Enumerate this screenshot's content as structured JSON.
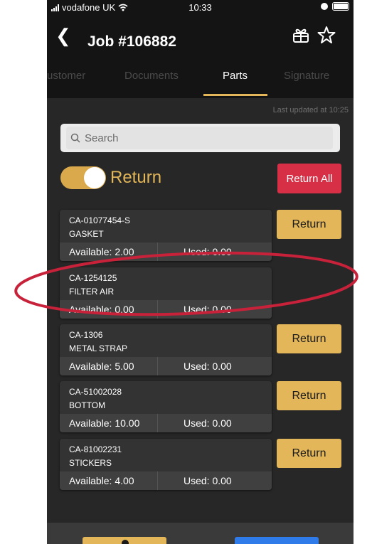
{
  "status_bar": {
    "carrier": "vodafone UK",
    "time": "10:33",
    "icons": [
      "signal-icon",
      "wifi-icon",
      "do-not-disturb-icon",
      "battery-icon"
    ]
  },
  "header": {
    "title": "Job #106882",
    "back_icon": "chevron-left-icon",
    "actions": [
      "gift-icon",
      "star-icon"
    ]
  },
  "tabs": [
    {
      "label": "ustomer",
      "active": false
    },
    {
      "label": "Documents",
      "active": false
    },
    {
      "label": "Parts",
      "active": true
    },
    {
      "label": "Signature",
      "active": false
    }
  ],
  "parts_page": {
    "last_updated": "Last updated at 10:25",
    "search_placeholder": "Search",
    "toggle_label": "Return",
    "toggle_on": true,
    "return_all_label": "Return All",
    "return_button_label": "Return",
    "items": [
      {
        "code": "CA-01077454-S",
        "name": "GASKET",
        "available": "Available: 2.00",
        "used": "Used: 0.00",
        "has_return": true
      },
      {
        "code": "CA-1254125",
        "name": "FILTER AIR",
        "available": "Available: 0.00",
        "used": "Used: 0.00",
        "has_return": false
      },
      {
        "code": "CA-1306",
        "name": "METAL STRAP",
        "available": "Available: 5.00",
        "used": "Used: 0.00",
        "has_return": true
      },
      {
        "code": "CA-51002028",
        "name": "BOTTOM",
        "available": "Available: 10.00",
        "used": "Used: 0.00",
        "has_return": true
      },
      {
        "code": "CA-81002231",
        "name": "STICKERS",
        "available": "Available: 4.00",
        "used": "Used: 0.00",
        "has_return": true
      }
    ]
  },
  "colors": {
    "accent": "#e3b659",
    "danger": "#d62f46",
    "annotation": "#c8213a",
    "background": "#141414",
    "panel": "#272727"
  }
}
